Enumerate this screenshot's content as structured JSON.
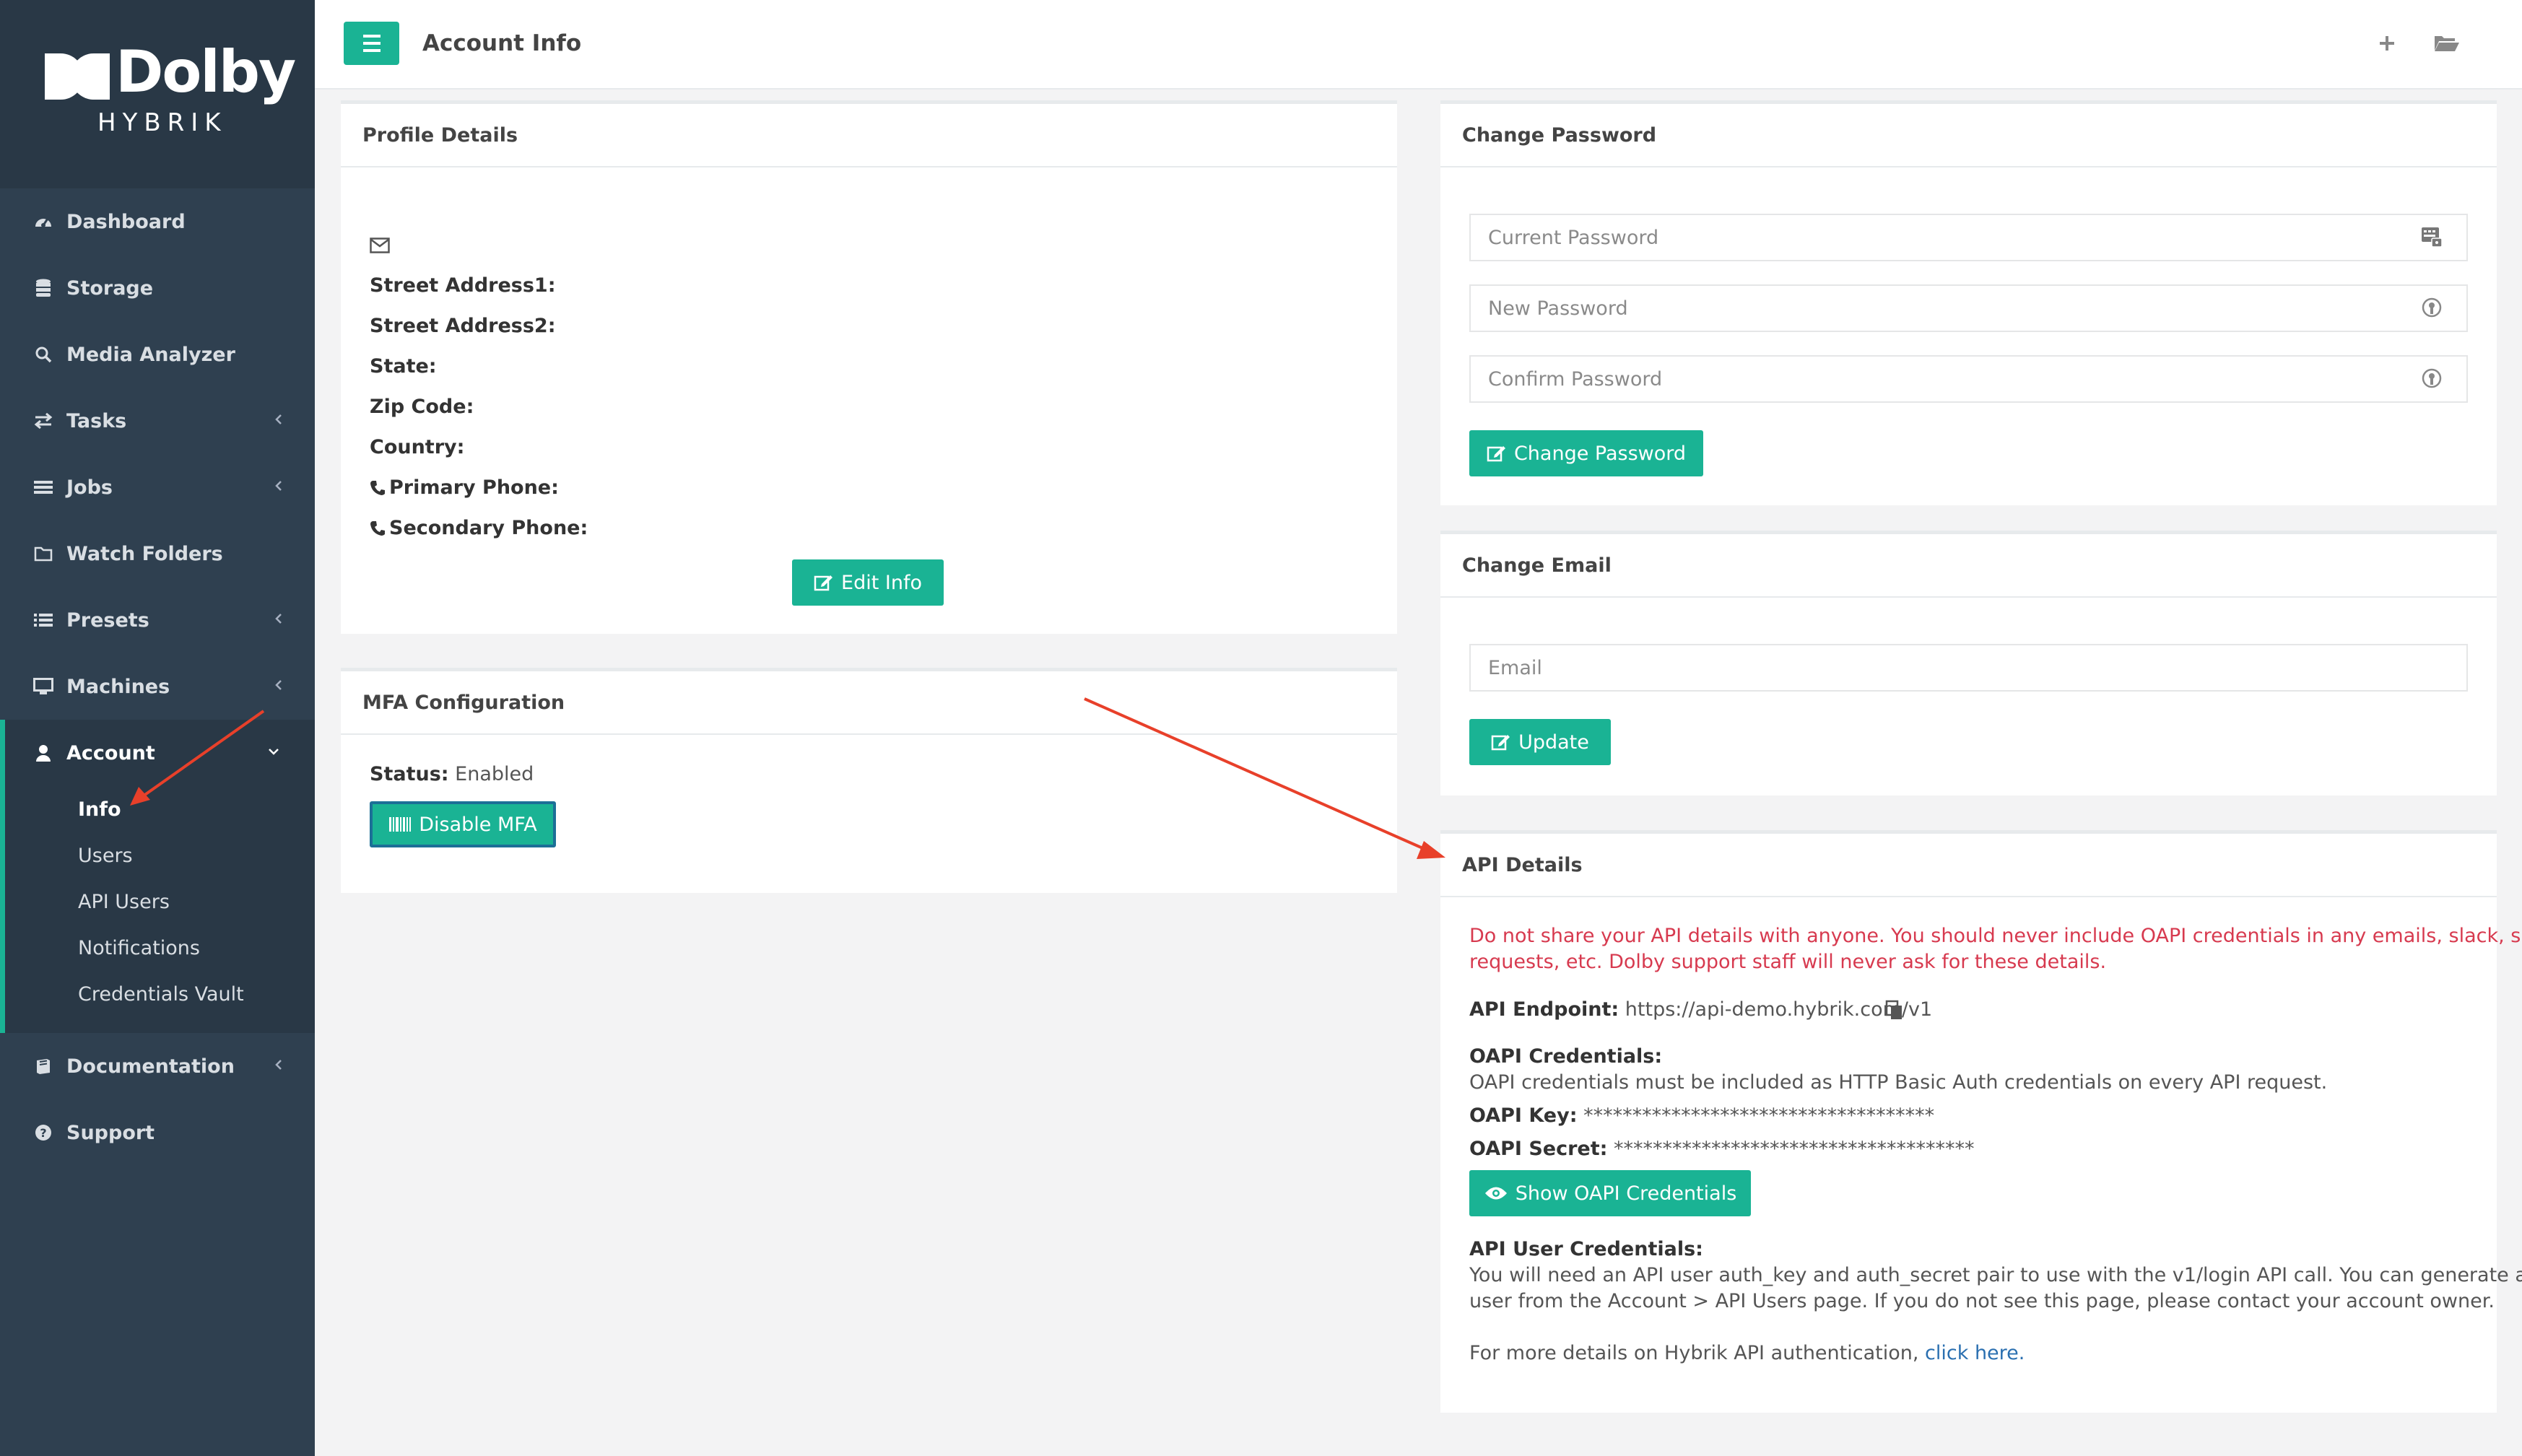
{
  "brand": {
    "word": "Dolby",
    "sub": "HYBRIK"
  },
  "topbar": {
    "title": "Account Info"
  },
  "sidebar": {
    "items": [
      {
        "label": "Dashboard",
        "icon": "dashboard-icon"
      },
      {
        "label": "Storage",
        "icon": "database-icon"
      },
      {
        "label": "Media Analyzer",
        "icon": "search-icon"
      },
      {
        "label": "Tasks",
        "icon": "exchange-icon"
      },
      {
        "label": "Jobs",
        "icon": "list-icon"
      },
      {
        "label": "Watch Folders",
        "icon": "folder-icon"
      },
      {
        "label": "Presets",
        "icon": "list-icon"
      },
      {
        "label": "Machines",
        "icon": "desktop-icon"
      }
    ],
    "account": {
      "label": "Account",
      "children": [
        "Info",
        "Users",
        "API Users",
        "Notifications",
        "Credentials Vault"
      ]
    },
    "bottom": [
      {
        "label": "Documentation",
        "icon": "book-icon"
      },
      {
        "label": "Support",
        "icon": "help-icon"
      }
    ]
  },
  "profile": {
    "title": "Profile Details",
    "fields": [
      "Street Address1:",
      "Street Address2:",
      "State:",
      "Zip Code:",
      "Country:",
      "Primary Phone:",
      "Secondary Phone:"
    ],
    "edit_label": "Edit Info"
  },
  "mfa": {
    "title": "MFA Configuration",
    "status_label": "Status:",
    "status_value": "Enabled",
    "button_label": "Disable MFA"
  },
  "password": {
    "title": "Change Password",
    "current_placeholder": "Current Password",
    "new_placeholder": "New Password",
    "confirm_placeholder": "Confirm Password",
    "button_label": "Change Password"
  },
  "email": {
    "title": "Change Email",
    "placeholder": "Email",
    "button_label": "Update"
  },
  "api": {
    "title": "API Details",
    "warning_line1": "Do not share your API details with anyone. You should never include OAPI credentials in any emails, slack, support",
    "warning_line2": "requests, etc. Dolby support staff will never ask for these details.",
    "endpoint_label": "API Endpoint:",
    "endpoint_value": "https://api-demo.hybrik.com/v1",
    "oapi_heading": "OAPI Credentials:",
    "oapi_desc": "OAPI credentials must be included as HTTP Basic Auth credentials on every API request.",
    "key_label": "OAPI Key:",
    "key_value": "************************************",
    "secret_label": "OAPI Secret:",
    "secret_value": "*************************************",
    "show_label": "Show OAPI Credentials",
    "user_heading": "API User Credentials:",
    "user_line1": "You will need an API user auth_key and auth_secret pair to use with the v1/login API call. You can generate an API",
    "user_line2": "user from the Account > API Users page. If you do not see this page, please contact your account owner.",
    "more_prefix": "For more details on Hybrik API authentication, ",
    "more_link": "click here."
  },
  "colors": {
    "accent": "#1ab394",
    "sidebar": "#2f4050",
    "warning": "#d73a4f",
    "annotation_arrow": "#e8402a"
  }
}
